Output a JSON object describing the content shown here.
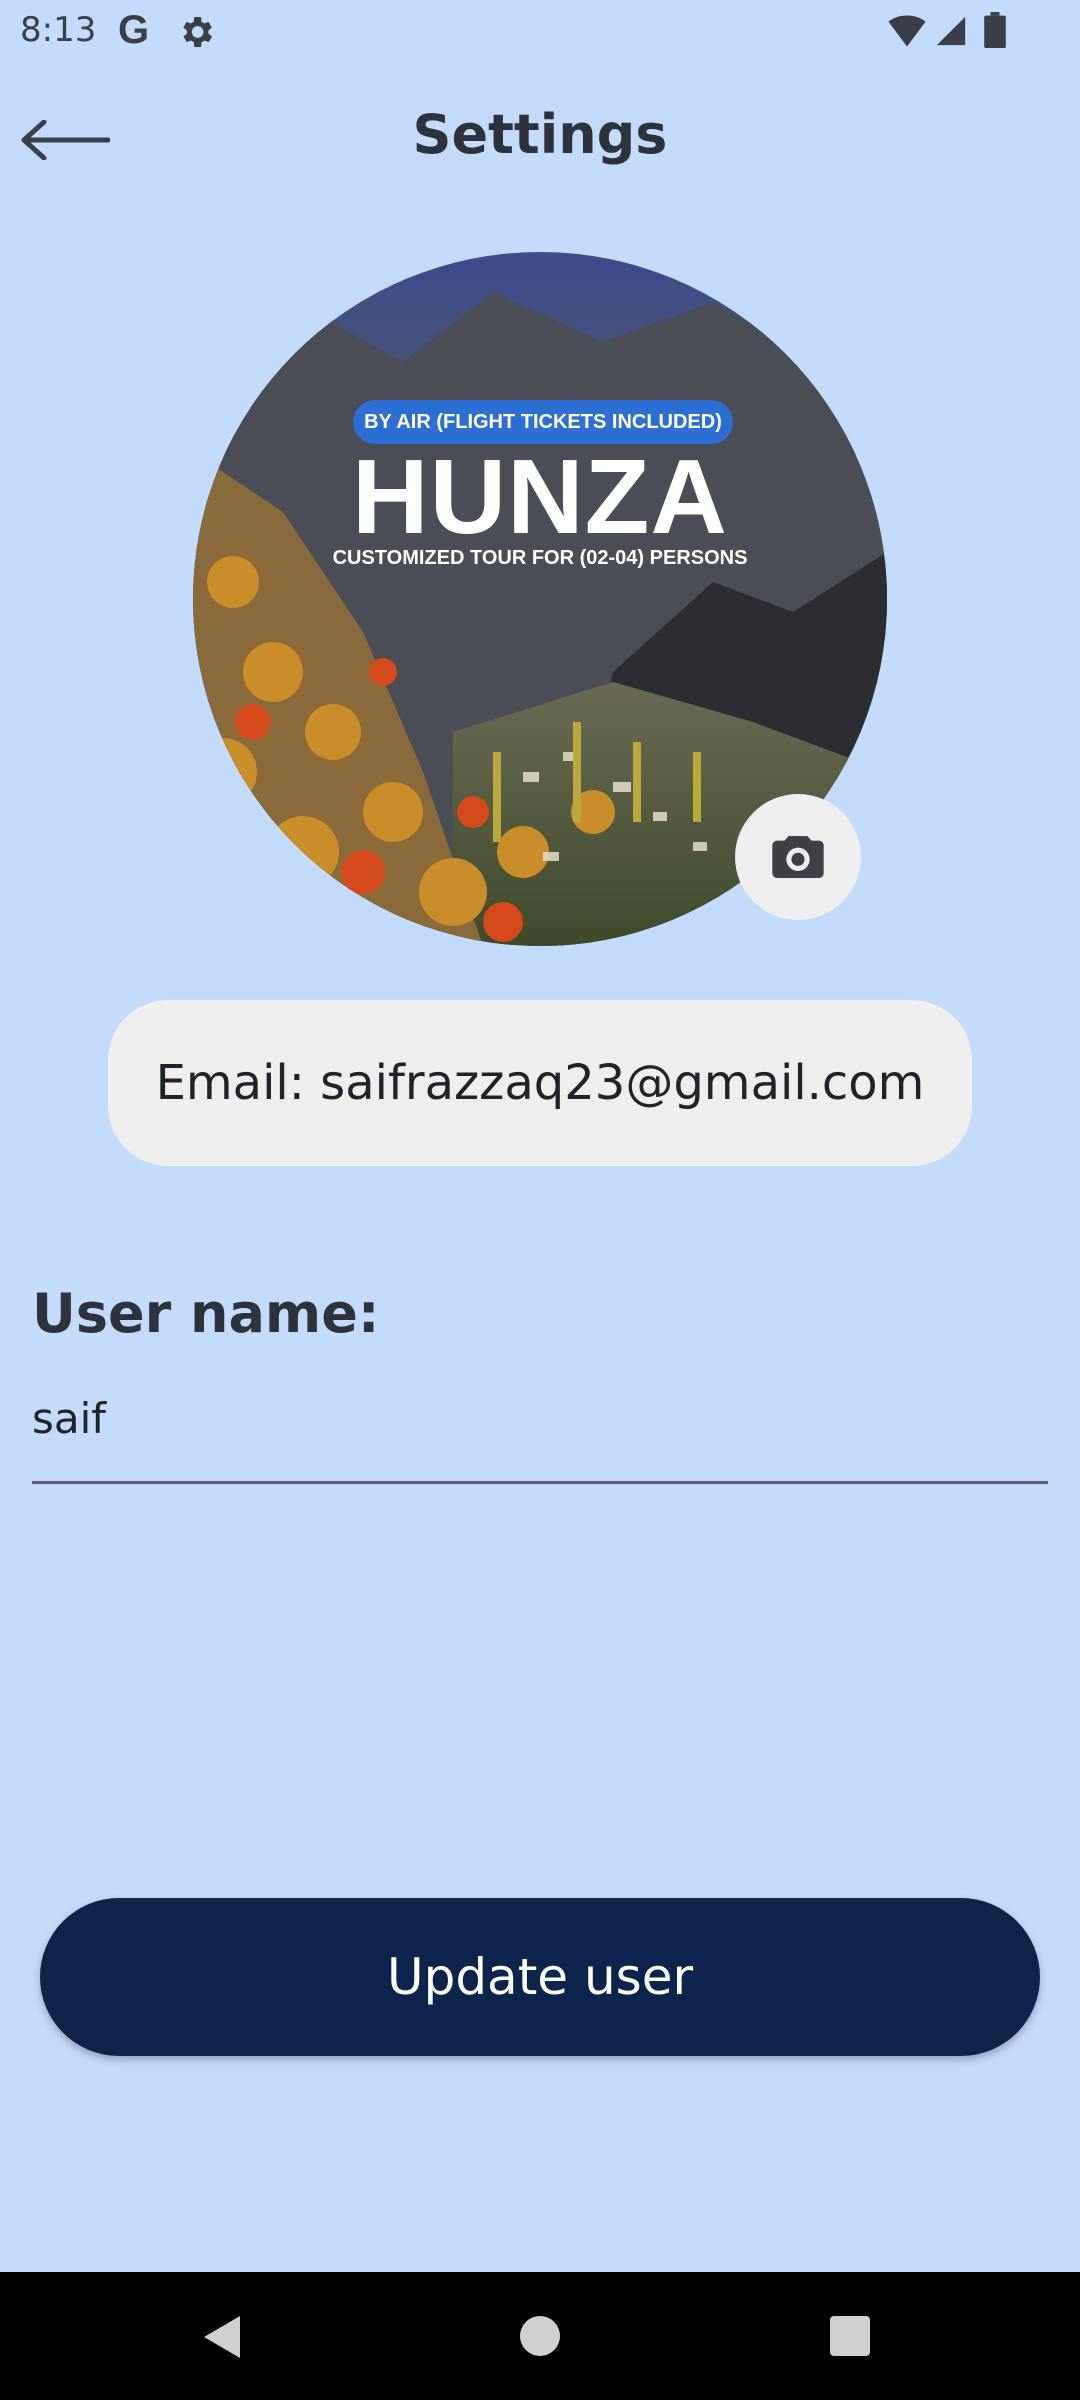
{
  "status_bar": {
    "time": "8:13",
    "g_icon": "G",
    "icons": [
      "settings-gear-icon",
      "wifi-icon",
      "signal-icon",
      "battery-icon"
    ]
  },
  "app_bar": {
    "title": "Settings",
    "back_icon": "arrow-left-icon"
  },
  "profile_image": {
    "badge": "BY AIR (FLIGHT TICKETS INCLUDED)",
    "title": "HUNZA",
    "subtitle": "CUSTOMIZED TOUR FOR (02-04) PERSONS",
    "camera_icon": "camera-icon"
  },
  "email": {
    "text": "Email: saifrazzaq23@gmail.com"
  },
  "username": {
    "label": "User name:",
    "value": "saif"
  },
  "actions": {
    "update_label": "Update user"
  },
  "colors": {
    "background": "#c3dbfc",
    "primary_button": "#0c244c",
    "pill": "#eeeeef",
    "badge": "#2d6ed3"
  }
}
